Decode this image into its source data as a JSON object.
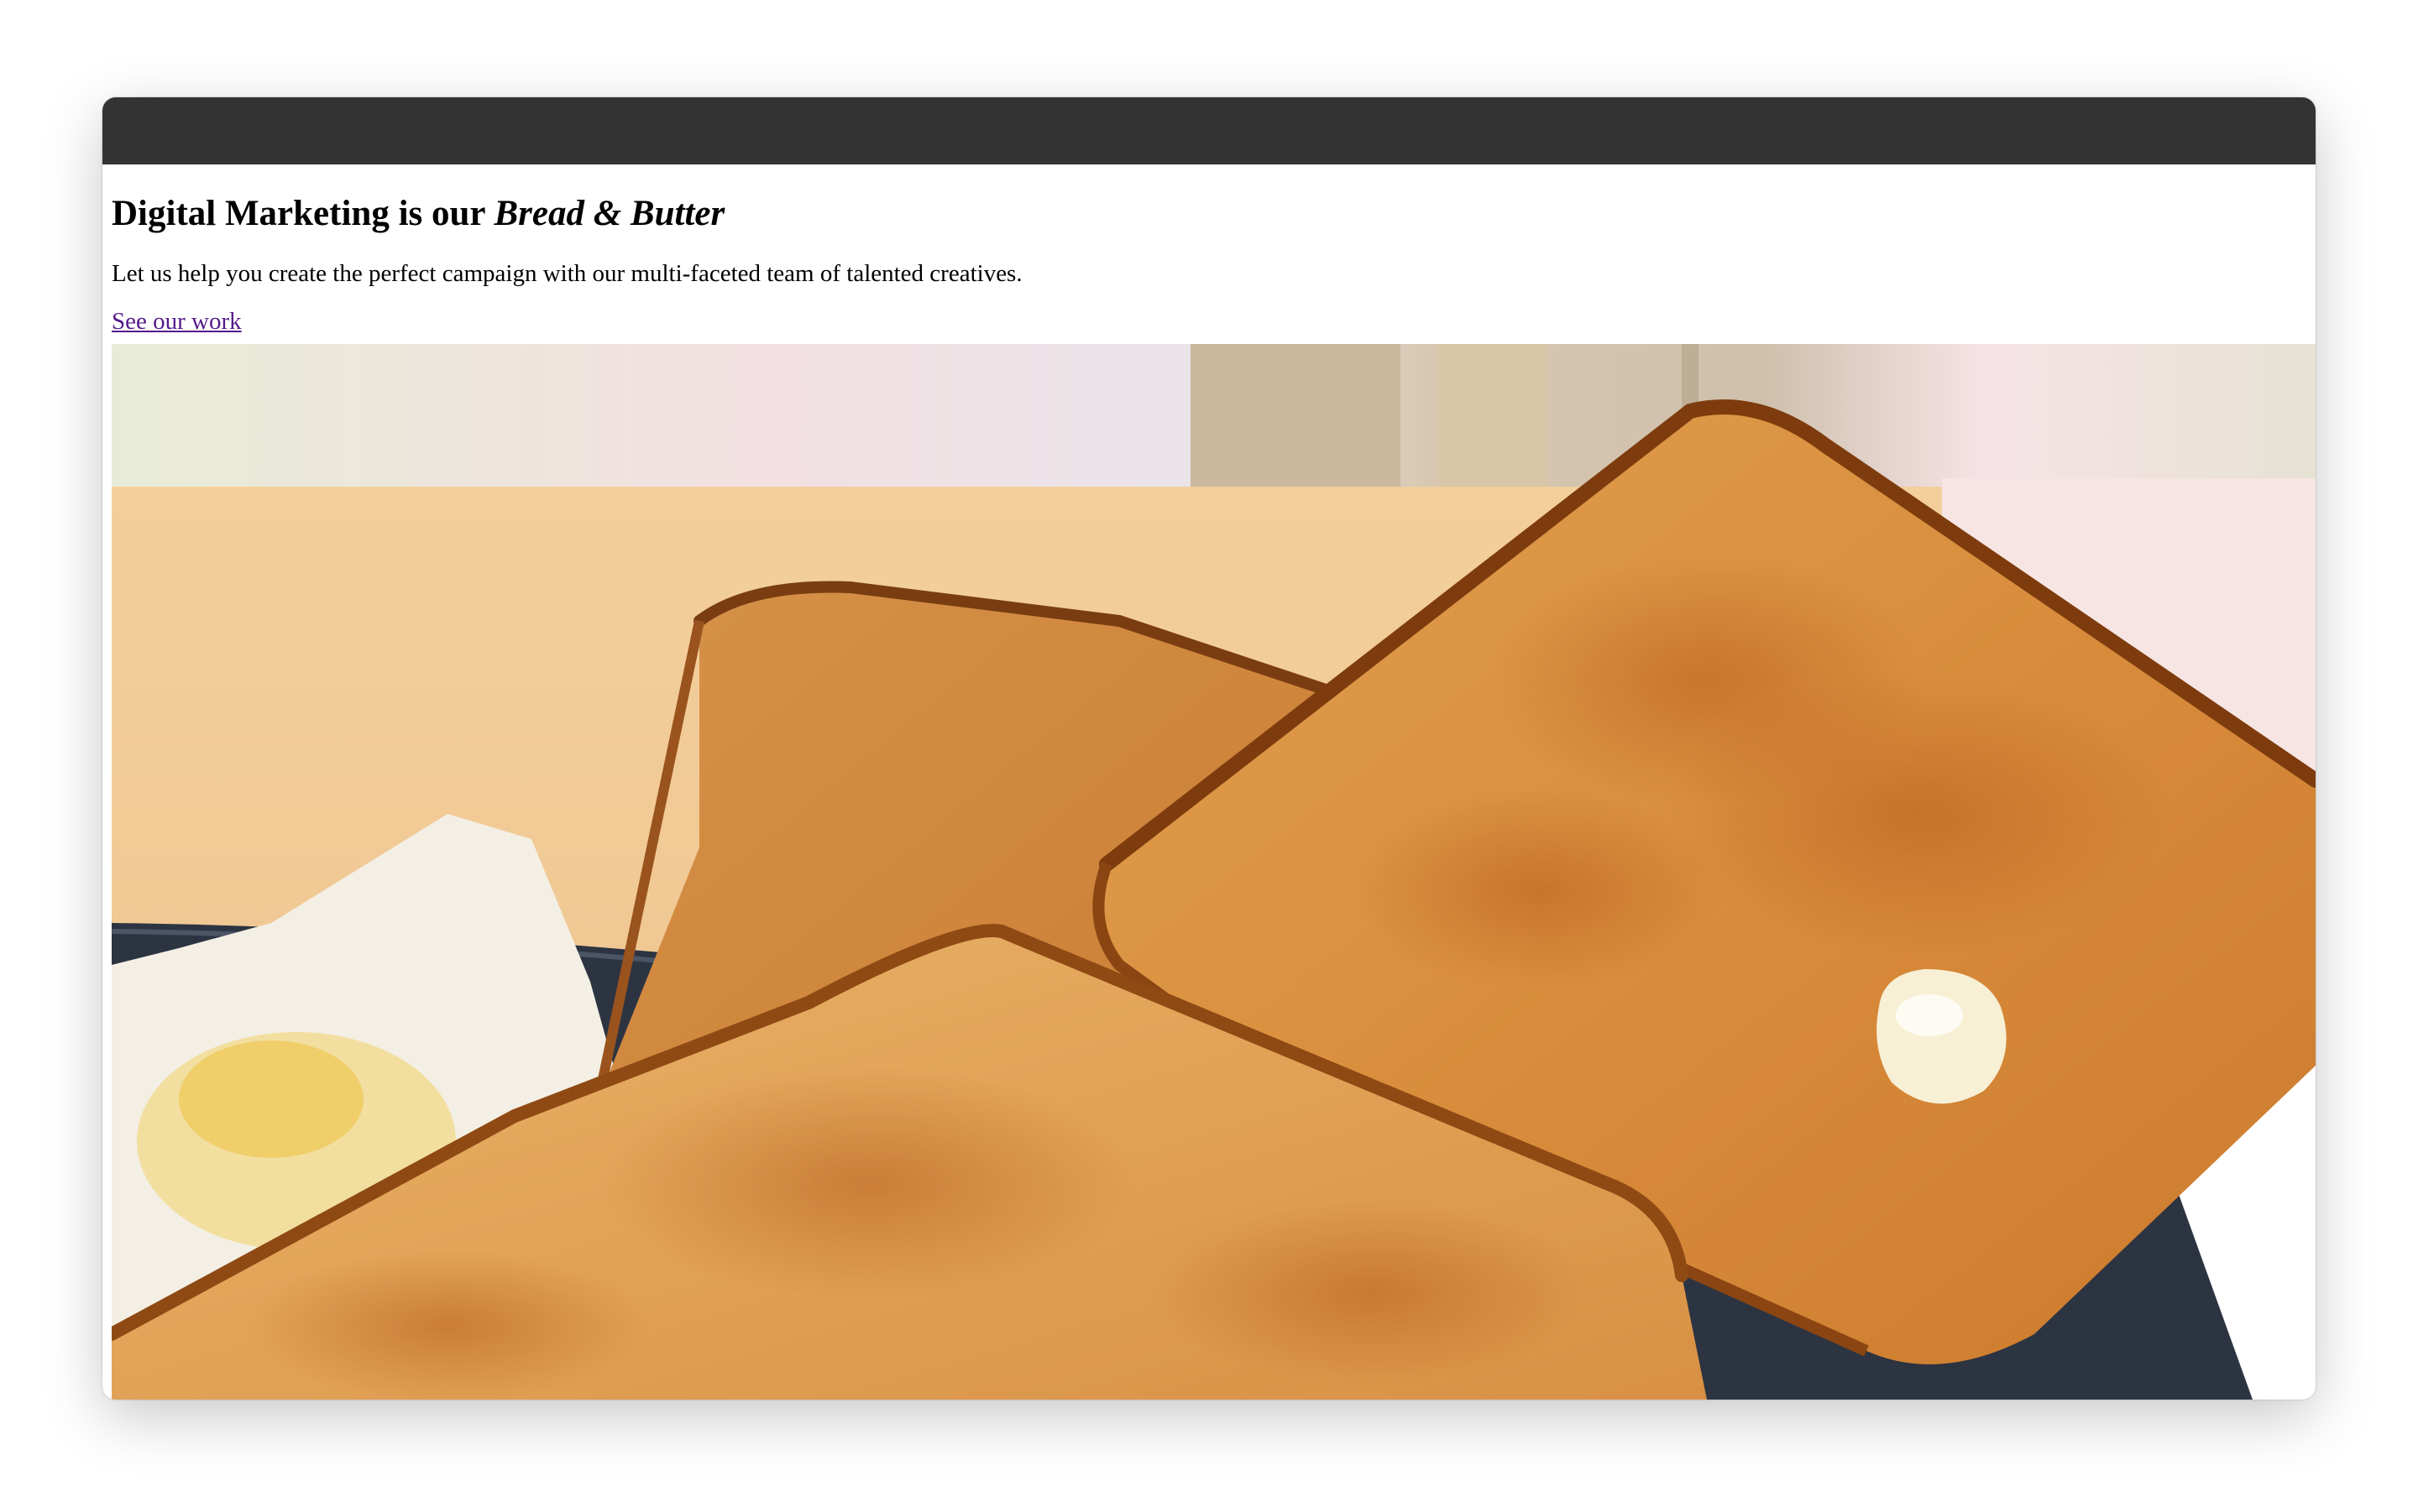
{
  "page": {
    "headline_lead": "Digital Marketing is our ",
    "headline_emphasis": "Bread & Butter",
    "lede": "Let us help you create the perfect campaign with our multi-faceted team of talented creatives.",
    "cta_label": "See our work"
  },
  "hero_image": {
    "subject": "toast-with-butter-photo"
  },
  "colors": {
    "titlebar": "#333333",
    "link_visited": "#551a8b"
  }
}
